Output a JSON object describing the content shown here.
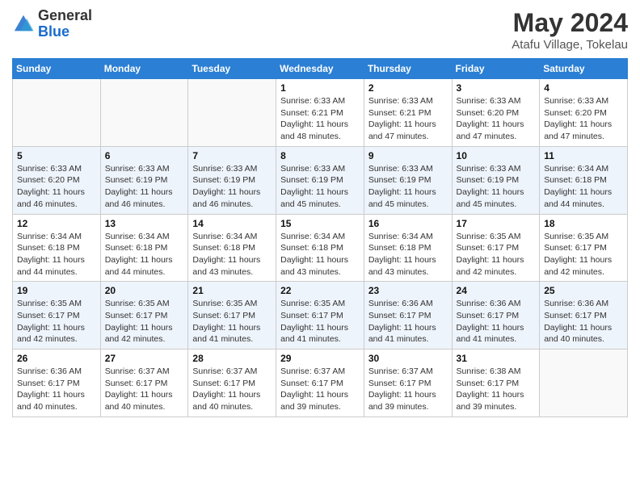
{
  "header": {
    "logo_general": "General",
    "logo_blue": "Blue",
    "month_title": "May 2024",
    "location": "Atafu Village, Tokelau"
  },
  "weekdays": [
    "Sunday",
    "Monday",
    "Tuesday",
    "Wednesday",
    "Thursday",
    "Friday",
    "Saturday"
  ],
  "weeks": [
    [
      {
        "day": "",
        "info": ""
      },
      {
        "day": "",
        "info": ""
      },
      {
        "day": "",
        "info": ""
      },
      {
        "day": "1",
        "info": "Sunrise: 6:33 AM\nSunset: 6:21 PM\nDaylight: 11 hours\nand 48 minutes."
      },
      {
        "day": "2",
        "info": "Sunrise: 6:33 AM\nSunset: 6:21 PM\nDaylight: 11 hours\nand 47 minutes."
      },
      {
        "day": "3",
        "info": "Sunrise: 6:33 AM\nSunset: 6:20 PM\nDaylight: 11 hours\nand 47 minutes."
      },
      {
        "day": "4",
        "info": "Sunrise: 6:33 AM\nSunset: 6:20 PM\nDaylight: 11 hours\nand 47 minutes."
      }
    ],
    [
      {
        "day": "5",
        "info": "Sunrise: 6:33 AM\nSunset: 6:20 PM\nDaylight: 11 hours\nand 46 minutes."
      },
      {
        "day": "6",
        "info": "Sunrise: 6:33 AM\nSunset: 6:19 PM\nDaylight: 11 hours\nand 46 minutes."
      },
      {
        "day": "7",
        "info": "Sunrise: 6:33 AM\nSunset: 6:19 PM\nDaylight: 11 hours\nand 46 minutes."
      },
      {
        "day": "8",
        "info": "Sunrise: 6:33 AM\nSunset: 6:19 PM\nDaylight: 11 hours\nand 45 minutes."
      },
      {
        "day": "9",
        "info": "Sunrise: 6:33 AM\nSunset: 6:19 PM\nDaylight: 11 hours\nand 45 minutes."
      },
      {
        "day": "10",
        "info": "Sunrise: 6:33 AM\nSunset: 6:19 PM\nDaylight: 11 hours\nand 45 minutes."
      },
      {
        "day": "11",
        "info": "Sunrise: 6:34 AM\nSunset: 6:18 PM\nDaylight: 11 hours\nand 44 minutes."
      }
    ],
    [
      {
        "day": "12",
        "info": "Sunrise: 6:34 AM\nSunset: 6:18 PM\nDaylight: 11 hours\nand 44 minutes."
      },
      {
        "day": "13",
        "info": "Sunrise: 6:34 AM\nSunset: 6:18 PM\nDaylight: 11 hours\nand 44 minutes."
      },
      {
        "day": "14",
        "info": "Sunrise: 6:34 AM\nSunset: 6:18 PM\nDaylight: 11 hours\nand 43 minutes."
      },
      {
        "day": "15",
        "info": "Sunrise: 6:34 AM\nSunset: 6:18 PM\nDaylight: 11 hours\nand 43 minutes."
      },
      {
        "day": "16",
        "info": "Sunrise: 6:34 AM\nSunset: 6:18 PM\nDaylight: 11 hours\nand 43 minutes."
      },
      {
        "day": "17",
        "info": "Sunrise: 6:35 AM\nSunset: 6:17 PM\nDaylight: 11 hours\nand 42 minutes."
      },
      {
        "day": "18",
        "info": "Sunrise: 6:35 AM\nSunset: 6:17 PM\nDaylight: 11 hours\nand 42 minutes."
      }
    ],
    [
      {
        "day": "19",
        "info": "Sunrise: 6:35 AM\nSunset: 6:17 PM\nDaylight: 11 hours\nand 42 minutes."
      },
      {
        "day": "20",
        "info": "Sunrise: 6:35 AM\nSunset: 6:17 PM\nDaylight: 11 hours\nand 42 minutes."
      },
      {
        "day": "21",
        "info": "Sunrise: 6:35 AM\nSunset: 6:17 PM\nDaylight: 11 hours\nand 41 minutes."
      },
      {
        "day": "22",
        "info": "Sunrise: 6:35 AM\nSunset: 6:17 PM\nDaylight: 11 hours\nand 41 minutes."
      },
      {
        "day": "23",
        "info": "Sunrise: 6:36 AM\nSunset: 6:17 PM\nDaylight: 11 hours\nand 41 minutes."
      },
      {
        "day": "24",
        "info": "Sunrise: 6:36 AM\nSunset: 6:17 PM\nDaylight: 11 hours\nand 41 minutes."
      },
      {
        "day": "25",
        "info": "Sunrise: 6:36 AM\nSunset: 6:17 PM\nDaylight: 11 hours\nand 40 minutes."
      }
    ],
    [
      {
        "day": "26",
        "info": "Sunrise: 6:36 AM\nSunset: 6:17 PM\nDaylight: 11 hours\nand 40 minutes."
      },
      {
        "day": "27",
        "info": "Sunrise: 6:37 AM\nSunset: 6:17 PM\nDaylight: 11 hours\nand 40 minutes."
      },
      {
        "day": "28",
        "info": "Sunrise: 6:37 AM\nSunset: 6:17 PM\nDaylight: 11 hours\nand 40 minutes."
      },
      {
        "day": "29",
        "info": "Sunrise: 6:37 AM\nSunset: 6:17 PM\nDaylight: 11 hours\nand 39 minutes."
      },
      {
        "day": "30",
        "info": "Sunrise: 6:37 AM\nSunset: 6:17 PM\nDaylight: 11 hours\nand 39 minutes."
      },
      {
        "day": "31",
        "info": "Sunrise: 6:38 AM\nSunset: 6:17 PM\nDaylight: 11 hours\nand 39 minutes."
      },
      {
        "day": "",
        "info": ""
      }
    ]
  ]
}
